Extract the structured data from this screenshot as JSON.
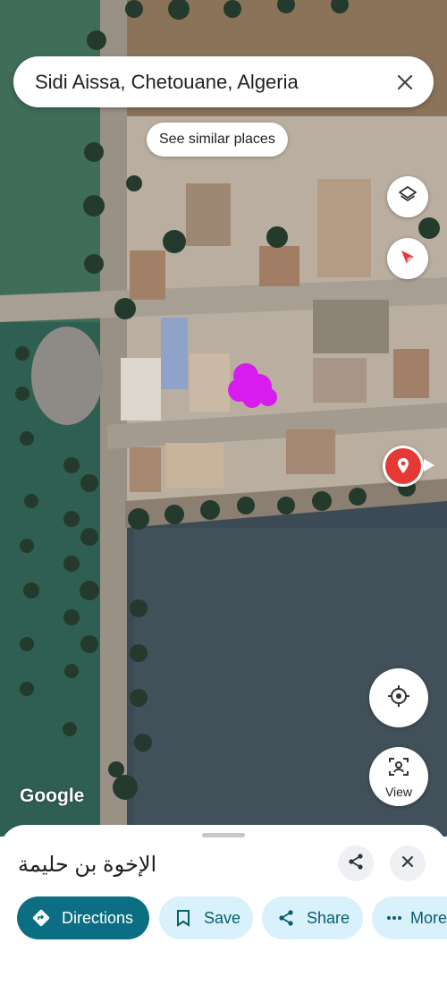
{
  "search": {
    "query": "Sidi Aissa, Chetouane, Algeria"
  },
  "chip": {
    "label": "See similar places"
  },
  "map": {
    "attribution": "Google",
    "view_label": "View"
  },
  "place": {
    "name": "الإخوة بن حليمة"
  },
  "actions": {
    "directions": "Directions",
    "save": "Save",
    "share": "Share",
    "more": "More"
  },
  "icons": {
    "layers": "layers-icon",
    "compass": "compass-icon",
    "pin": "place-pin-icon",
    "location": "my-location-icon",
    "view": "street-view-icon"
  },
  "colors": {
    "primary_button": "#0b6e82",
    "secondary_button": "#d8f1fa",
    "pin_red": "#e53935",
    "marker_purple": "#d81cf0"
  }
}
